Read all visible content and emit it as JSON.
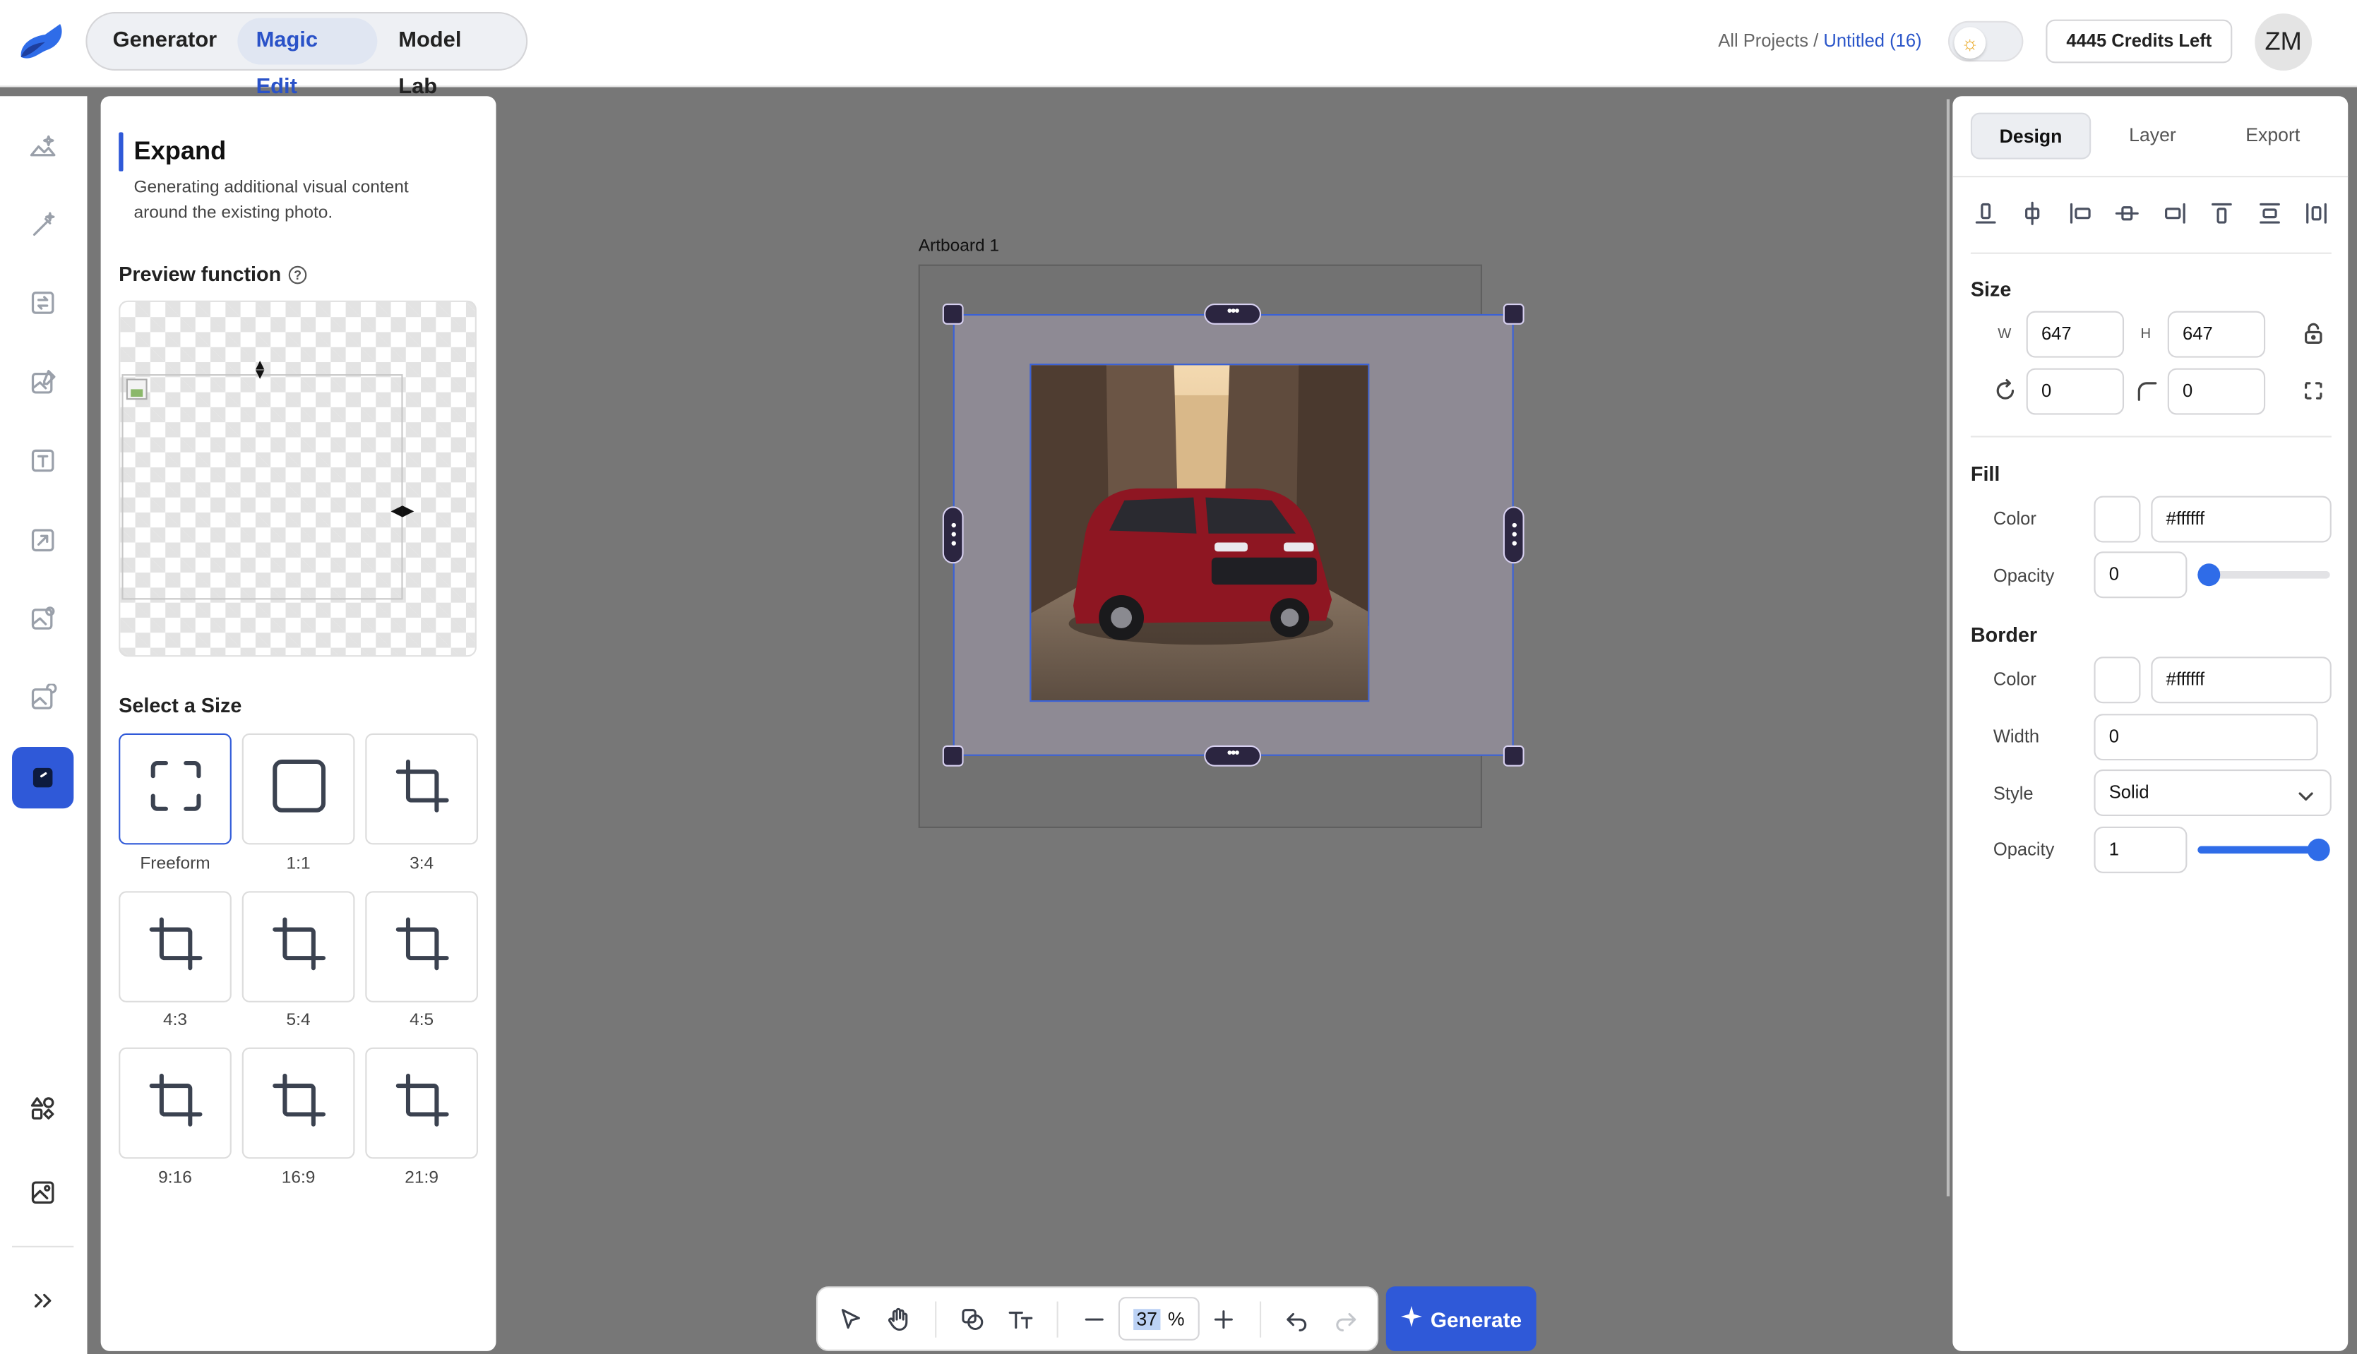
{
  "app": {
    "logo_icon": "brand-swoosh-logo",
    "brand_color": "#2f59d8"
  },
  "nav": {
    "tabs": [
      {
        "label": "Generator"
      },
      {
        "label": "Magic Edit"
      },
      {
        "label": "Model Lab"
      }
    ],
    "active": "Magic Edit"
  },
  "breadcrumb": {
    "root": "All Projects",
    "separator": "/",
    "current": "Untitled (16)"
  },
  "header": {
    "theme_icon": "sun-icon",
    "credits": "4445 Credits Left",
    "avatar_initials": "ZM"
  },
  "rail": {
    "icons": [
      "landscape-sparkle-icon",
      "magic-wand-icon",
      "swap-image-icon",
      "image-edit-icon",
      "text-box-icon",
      "image-arrow-icon",
      "image-settings-icon",
      "image-redo-icon",
      "expand-image-icon",
      "shapes-icon",
      "gallery-icon",
      "chevrons-right-icon"
    ],
    "active": "expand-image-icon"
  },
  "expand_panel": {
    "title": "Expand",
    "description": "Generating additional visual content around the existing photo.",
    "preview_label": "Preview function",
    "help_icon": "?",
    "size_label": "Select a Size",
    "sizes": [
      {
        "label": "Freeform",
        "icon": "freeform-corners-icon"
      },
      {
        "label": "1:1",
        "icon": "square-icon"
      },
      {
        "label": "3:4",
        "icon": "crop-icon"
      },
      {
        "label": "4:3",
        "icon": "crop-icon"
      },
      {
        "label": "5:4",
        "icon": "crop-icon"
      },
      {
        "label": "4:5",
        "icon": "crop-icon"
      },
      {
        "label": "9:16",
        "icon": "crop-icon"
      },
      {
        "label": "16:9",
        "icon": "crop-icon"
      },
      {
        "label": "21:9",
        "icon": "crop-icon"
      }
    ],
    "selected_size": "Freeform"
  },
  "canvas": {
    "artboard_label": "Artboard 1",
    "photo_subject": "red car on cobblestone street"
  },
  "toolbar": {
    "icons": [
      "pointer-icon",
      "hand-icon",
      "shapes-icon",
      "text-icon",
      "zoom-out-icon",
      "zoom-in-icon",
      "undo-icon",
      "redo-icon"
    ],
    "zoom_value": "37",
    "zoom_unit": "%",
    "generate_label": "Generate",
    "generate_icon": "sparkle-icon"
  },
  "design_panel": {
    "tabs": [
      {
        "label": "Design"
      },
      {
        "label": "Layer"
      },
      {
        "label": "Export"
      }
    ],
    "active_tab": "Design",
    "align_icons": [
      "align-bottom-icon",
      "align-vertical-center-icon",
      "align-left-icon",
      "align-horizontal-center-icon",
      "align-right-icon",
      "align-top-icon",
      "distribute-vertical-icon",
      "distribute-horizontal-icon"
    ],
    "size": {
      "heading": "Size",
      "w_label": "W",
      "w_value": "647",
      "h_label": "H",
      "h_value": "647",
      "rotation_value": "0",
      "radius_value": "0"
    },
    "fill": {
      "heading": "Fill",
      "color_label": "Color",
      "color_value": "#ffffff",
      "opacity_label": "Opacity",
      "opacity_value": "0",
      "opacity_level": 0.0
    },
    "border": {
      "heading": "Border",
      "color_label": "Color",
      "color_value": "#ffffff",
      "width_label": "Width",
      "width_value": "0",
      "style_label": "Style",
      "style_value": "Solid",
      "opacity_label": "Opacity",
      "opacity_value": "1",
      "opacity_level": 1.0
    }
  }
}
